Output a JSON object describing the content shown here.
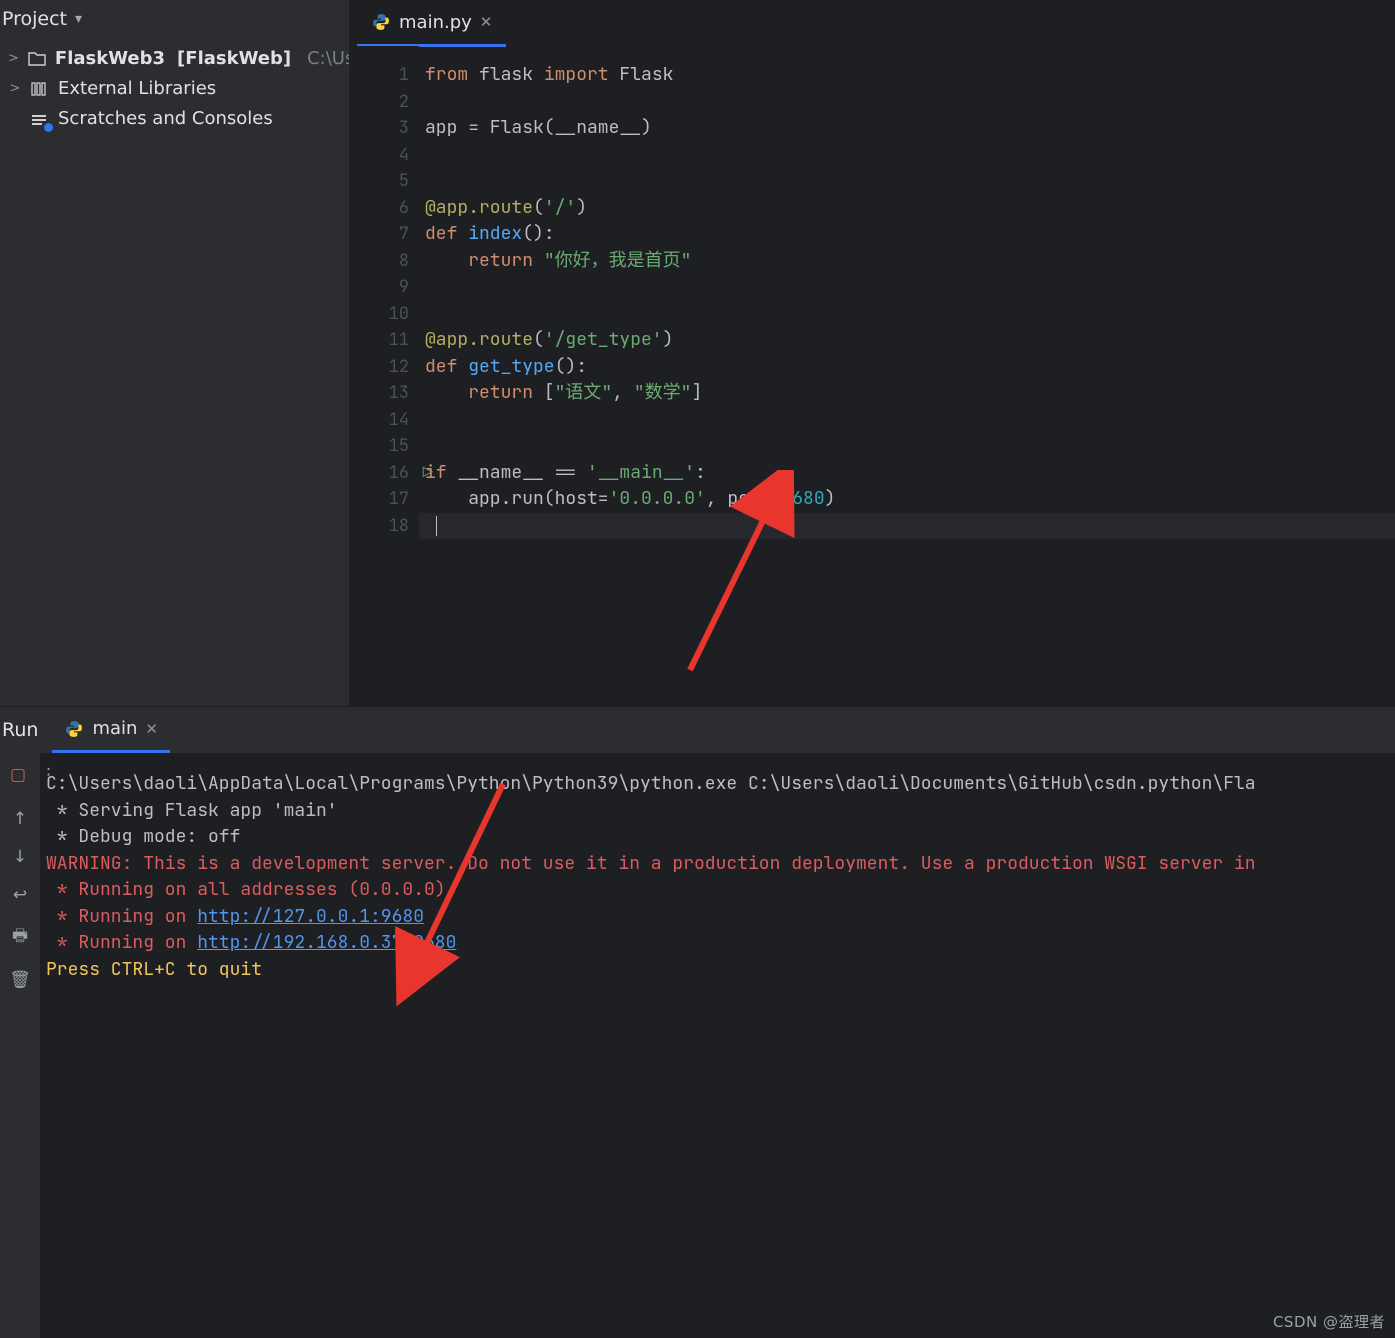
{
  "sidebar": {
    "title": "Project",
    "items": [
      {
        "expander": ">",
        "icon": "folder",
        "label": "FlaskWeb3",
        "suffix": "[FlaskWeb]",
        "path": "C:\\Users\\daoli\\l"
      },
      {
        "expander": ">",
        "icon": "library",
        "label": "External Libraries",
        "suffix": "",
        "path": ""
      },
      {
        "expander": "",
        "icon": "scratches",
        "label": "Scratches and Consoles",
        "suffix": "",
        "path": ""
      }
    ]
  },
  "editor": {
    "tab_icon": "python",
    "tab_label": "main.py",
    "run_icon_line": 16,
    "code_lines": [
      [
        [
          "kw",
          "from"
        ],
        [
          "pl",
          " flask "
        ],
        [
          "kw",
          "import"
        ],
        [
          "pl",
          " Flask"
        ]
      ],
      [],
      [
        [
          "pl",
          "app = Flask(__name__)"
        ]
      ],
      [],
      [],
      [
        [
          "dec",
          "@app.route"
        ],
        [
          "pl",
          "("
        ],
        [
          "str",
          "'/'"
        ],
        [
          "pl",
          ")"
        ]
      ],
      [
        [
          "kw",
          "def "
        ],
        [
          "fn",
          "index"
        ],
        [
          "pl",
          "():"
        ]
      ],
      [
        [
          "pl",
          "    "
        ],
        [
          "kw",
          "return"
        ],
        [
          "pl",
          " "
        ],
        [
          "str",
          "\"你好，我是首页\""
        ]
      ],
      [],
      [],
      [
        [
          "dec",
          "@app.route"
        ],
        [
          "pl",
          "("
        ],
        [
          "str",
          "'/get_type'"
        ],
        [
          "pl",
          ")"
        ]
      ],
      [
        [
          "kw",
          "def "
        ],
        [
          "fn",
          "get_type"
        ],
        [
          "pl",
          "():"
        ]
      ],
      [
        [
          "pl",
          "    "
        ],
        [
          "kw",
          "return"
        ],
        [
          "pl",
          " ["
        ],
        [
          "str",
          "\"语文\""
        ],
        [
          "pl",
          ", "
        ],
        [
          "str",
          "\"数学\""
        ],
        [
          "pl",
          "]"
        ]
      ],
      [],
      [],
      [
        [
          "kw",
          "if"
        ],
        [
          "pl",
          " __name__ == "
        ],
        [
          "str",
          "'__main__'"
        ],
        [
          "pl",
          ":"
        ]
      ],
      [
        [
          "pl",
          "    app.run("
        ],
        [
          "pl",
          "host="
        ],
        [
          "str",
          "'0.0.0.0'"
        ],
        [
          "pl",
          ", "
        ],
        [
          "pl",
          "port="
        ],
        [
          "num",
          "9680"
        ],
        [
          "pl",
          ")"
        ]
      ],
      []
    ]
  },
  "run": {
    "panel_title": "Run",
    "tab_icon": "python",
    "tab_label": "main",
    "toolbar_icons": [
      "rerun",
      "stop",
      "more",
      "up",
      "down",
      "wrap",
      "print",
      "trash"
    ],
    "console_lines": [
      {
        "segs": [
          [
            "pl",
            "C:\\Users\\daoli\\AppData\\Local\\Programs\\Python\\Python39\\python.exe C:\\Users\\daoli\\Documents\\GitHub\\csdn.python\\Fla"
          ]
        ]
      },
      {
        "segs": [
          [
            "pl",
            " * Serving Flask app 'main'"
          ]
        ]
      },
      {
        "segs": [
          [
            "pl",
            " * Debug mode: off"
          ]
        ]
      },
      {
        "segs": [
          [
            "warn",
            "WARNING: This is a development server. Do not use it in a production deployment. Use a production WSGI server in"
          ]
        ]
      },
      {
        "segs": [
          [
            "warn",
            " * Running on all addresses (0.0.0.0)"
          ]
        ]
      },
      {
        "segs": [
          [
            "warn",
            " * Running on "
          ],
          [
            "link",
            "http://127.0.0.1:9680"
          ]
        ]
      },
      {
        "segs": [
          [
            "warn",
            " * Running on "
          ],
          [
            "link",
            "http://192.168.0.37:9680"
          ]
        ]
      },
      {
        "segs": [
          [
            "prompt",
            "Press CTRL+C to quit"
          ]
        ]
      }
    ]
  },
  "watermark": "CSDN @盗理者"
}
